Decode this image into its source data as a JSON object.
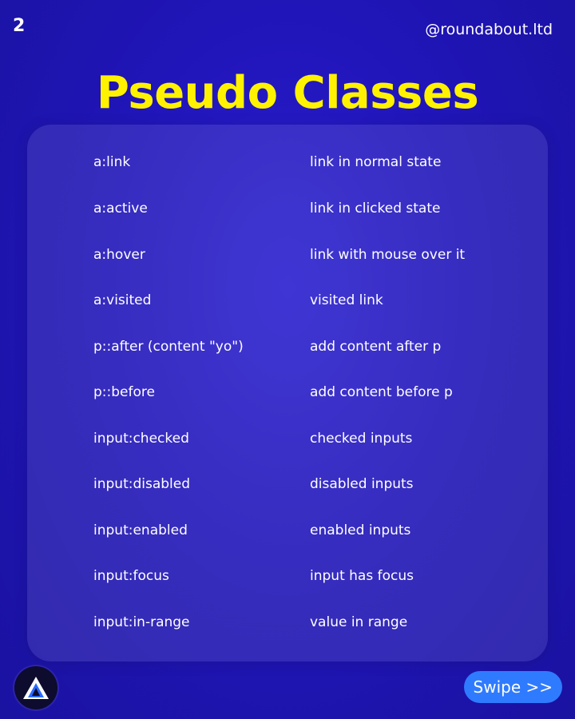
{
  "page_number": "2",
  "handle": "@roundabout.ltd",
  "title": "Pseudo Classes",
  "rows": [
    {
      "selector": "a:link",
      "description": "link in normal state"
    },
    {
      "selector": "a:active",
      "description": "link in clicked state"
    },
    {
      "selector": "a:hover",
      "description": "link with mouse over it"
    },
    {
      "selector": "a:visited",
      "description": "visited link"
    },
    {
      "selector": "p::after (content \"yo\")",
      "description": "add content after p"
    },
    {
      "selector": "p::before",
      "description": "add content before p"
    },
    {
      "selector": "input:checked",
      "description": "checked inputs"
    },
    {
      "selector": "input:disabled",
      "description": "disabled inputs"
    },
    {
      "selector": "input:enabled",
      "description": "enabled inputs"
    },
    {
      "selector": "input:focus",
      "description": "input has focus"
    },
    {
      "selector": "input:in-range",
      "description": "value in range"
    }
  ],
  "swipe_label": "Swipe >>",
  "logo_icon": "roundabout-logo-icon",
  "colors": {
    "background": "#2015b8",
    "title": "#fff200",
    "swipe_button": "#2f7bff"
  }
}
